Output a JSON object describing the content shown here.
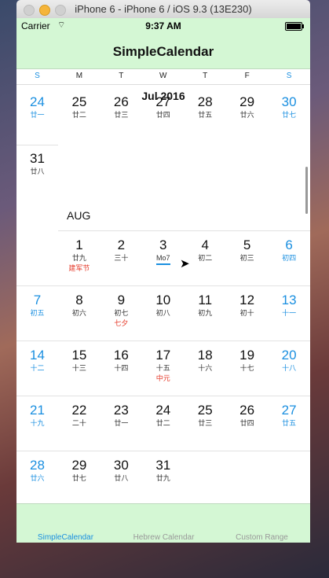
{
  "window": {
    "title": "iPhone 6 - iPhone 6 / iOS 9.3 (13E230)"
  },
  "status": {
    "carrier": "Carrier",
    "wifi": "⌔",
    "time": "9:37 AM"
  },
  "nav": {
    "title": "SimpleCalendar"
  },
  "weekdays": [
    "S",
    "M",
    "T",
    "W",
    "T",
    "F",
    "S"
  ],
  "calendar": {
    "jul_title": "Jul 2016",
    "aug_label": "AUG",
    "jul_row": [
      {
        "num": "24",
        "lun": "廿一",
        "weekend": true
      },
      {
        "num": "25",
        "lun": "廿二"
      },
      {
        "num": "26",
        "lun": "廿三"
      },
      {
        "num": "27",
        "lun": "廿四"
      },
      {
        "num": "28",
        "lun": "廿五"
      },
      {
        "num": "29",
        "lun": "廿六"
      },
      {
        "num": "30",
        "lun": "廿七",
        "weekend": true
      }
    ],
    "jul_31": {
      "num": "31",
      "lun": "廿八"
    },
    "aug_rows": [
      [
        null,
        {
          "num": "1",
          "lun": "廿九",
          "fest": "建军节"
        },
        {
          "num": "2",
          "lun": "三十"
        },
        {
          "num": "3",
          "lun": "Mo7",
          "underline": true
        },
        {
          "num": "4",
          "lun": "初二"
        },
        {
          "num": "5",
          "lun": "初三"
        },
        {
          "num": "6",
          "lun": "初四",
          "weekend": true
        }
      ],
      [
        {
          "num": "7",
          "lun": "初五",
          "weekend": true
        },
        {
          "num": "8",
          "lun": "初六"
        },
        {
          "num": "9",
          "lun": "初七",
          "fest": "七夕"
        },
        {
          "num": "10",
          "lun": "初八"
        },
        {
          "num": "11",
          "lun": "初九"
        },
        {
          "num": "12",
          "lun": "初十"
        },
        {
          "num": "13",
          "lun": "十一",
          "weekend": true
        }
      ],
      [
        {
          "num": "14",
          "lun": "十二",
          "weekend": true
        },
        {
          "num": "15",
          "lun": "十三"
        },
        {
          "num": "16",
          "lun": "十四"
        },
        {
          "num": "17",
          "lun": "十五",
          "fest": "中元"
        },
        {
          "num": "18",
          "lun": "十六"
        },
        {
          "num": "19",
          "lun": "十七"
        },
        {
          "num": "20",
          "lun": "十八",
          "weekend": true
        }
      ],
      [
        {
          "num": "21",
          "lun": "十九",
          "weekend": true
        },
        {
          "num": "22",
          "lun": "二十"
        },
        {
          "num": "23",
          "lun": "廿一"
        },
        {
          "num": "24",
          "lun": "廿二"
        },
        {
          "num": "25",
          "lun": "廿三"
        },
        {
          "num": "26",
          "lun": "廿四"
        },
        {
          "num": "27",
          "lun": "廿五",
          "weekend": true
        }
      ],
      [
        {
          "num": "28",
          "lun": "廿六",
          "weekend": true
        },
        {
          "num": "29",
          "lun": "廿七"
        },
        {
          "num": "30",
          "lun": "廿八"
        },
        {
          "num": "31",
          "lun": "廿九"
        },
        null,
        null,
        null
      ]
    ]
  },
  "tabs": [
    {
      "label": "SimpleCalendar",
      "active": true
    },
    {
      "label": "Hebrew Calendar",
      "active": false
    },
    {
      "label": "Custom Range",
      "active": false
    }
  ],
  "colors": {
    "accent": "#1a8fe0",
    "bar": "#d4f7d4",
    "festival": "#e53a2a"
  }
}
